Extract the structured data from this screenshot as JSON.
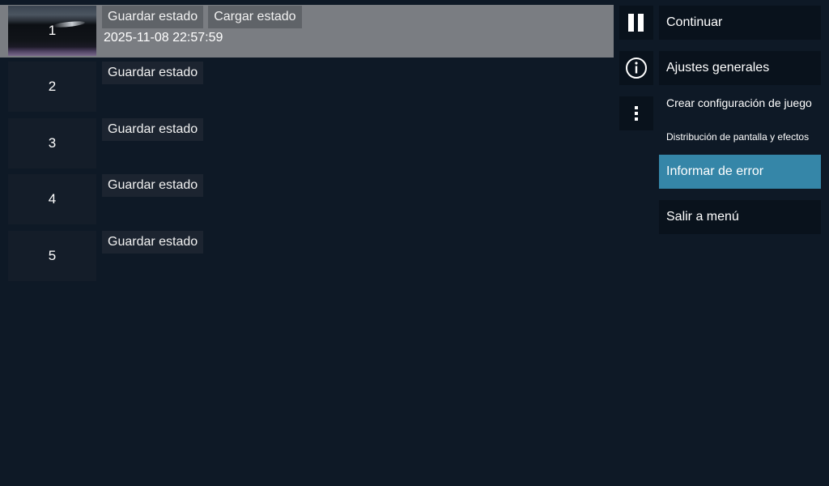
{
  "slots": [
    {
      "number": "1",
      "save_label": "Guardar estado",
      "load_label": "Cargar estado",
      "date": "2025-11-08 22:57:59"
    },
    {
      "number": "2",
      "save_label": "Guardar estado"
    },
    {
      "number": "3",
      "save_label": "Guardar estado"
    },
    {
      "number": "4",
      "save_label": "Guardar estado"
    },
    {
      "number": "5",
      "save_label": "Guardar estado"
    }
  ],
  "icons": {
    "pause": "pause-icon",
    "info": "info-icon",
    "more": "more-vertical-icon"
  },
  "menu": {
    "continue": "Continuar",
    "general_settings": "Ajustes generales",
    "create_game_config": "Crear configuración de juego",
    "screen_layout_effects": "Distribución de pantalla y efectos",
    "report_error": "Informar de error",
    "exit_menu": "Salir a menú"
  },
  "colors": {
    "background": "#0e1926",
    "selected_slot": "#7a7d82",
    "highlight": "#3586a8",
    "button_dark": "#09121c"
  }
}
